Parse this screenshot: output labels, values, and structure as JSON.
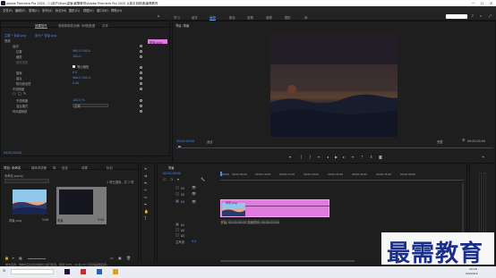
{
  "titlebar": {
    "title": "Adobe Premiere Pro 2020 - C:\\用户\\Xiao\\桌面\\最需教育\\Adobe Premiere Pro 2020 从新手到精通\\最需教育",
    "min": "—",
    "max": "☐",
    "close": "✕"
  },
  "menu": [
    "文件(F)",
    "编辑(E)",
    "剪辑(C)",
    "序列(S)",
    "标记(M)",
    "图形(G)",
    "视图(V)",
    "窗口(W)",
    "帮助(H)"
  ],
  "workspaces": [
    "学习",
    "组件",
    "编辑",
    "颜色",
    "效果",
    "音频",
    "图形",
    "库"
  ],
  "active_workspace": "编辑",
  "effect_controls": {
    "tabs": [
      "效果控件",
      "音频剪辑混合器: 序列",
      "元数据",
      "文本"
    ],
    "active_tab": "效果控件",
    "source": "主要 * 背景.png",
    "seq": "序列 * 背景.png",
    "clip_chip": "背景.png",
    "sections": [
      {
        "name": "视频",
        "indent": 0
      },
      {
        "name": "运动",
        "indent": 1
      },
      {
        "name": "位置",
        "indent": 2,
        "value": "960.0   540.0"
      },
      {
        "name": "缩放",
        "indent": 2,
        "value": "100.0"
      },
      {
        "name": "缩放宽度",
        "indent": 2,
        "value": ""
      },
      {
        "name": "等比缩放",
        "indent": 2,
        "checkbox": true
      },
      {
        "name": "旋转",
        "indent": 2,
        "value": "0.0"
      },
      {
        "name": "锚点",
        "indent": 2,
        "value": "960.0   540.0"
      },
      {
        "name": "防闪烁滤镜",
        "indent": 2,
        "value": "0.00"
      },
      {
        "name": "不透明度",
        "indent": 1
      },
      {
        "name": "不透明度",
        "indent": 2,
        "value": "100.0 %"
      },
      {
        "name": "混合模式",
        "indent": 2,
        "value": "正常"
      },
      {
        "name": "时间重映射",
        "indent": 1
      }
    ],
    "timecode": "00:00:00:00"
  },
  "program_monitor": {
    "tab": "节目: 背景",
    "timecode": "00:00:00:00",
    "zoom": "适合",
    "quality": "完整",
    "duration": "00:00:05:00"
  },
  "project": {
    "tabs": [
      "项目: 未命名",
      "媒体浏览器",
      "库",
      "信息",
      "效果",
      "标记"
    ],
    "project_name": "未命名.prproj",
    "count": "1 项已选择，共 2 项",
    "items": [
      {
        "name": "背景.png",
        "duration": "5:00"
      },
      {
        "name": "背景",
        "duration": "5:00"
      }
    ]
  },
  "timeline": {
    "tab": "背景",
    "timecode": "00:00:00:00",
    "ruler": [
      "00:00",
      "00:00:05:00",
      "00:00:10:00",
      "00:00:15:00",
      "00:00:20:00",
      "00:00:25:00",
      "00:00:30:00",
      "00:00:35:00",
      "00:00:40:00"
    ],
    "video_tracks": [
      "V3",
      "V2",
      "V1"
    ],
    "audio_tracks": [
      "A1",
      "A2",
      "A3"
    ],
    "master": "主声道",
    "master_value": "0.0",
    "clip_label": "背景.png",
    "tooltip": "开始: 00:00:00:00 持续时间: 00:00:05:00"
  },
  "status": "单击选择，或单击空白处并拖动以进行框选。使用 Shift、Alt 和 Ctrl 可获得其他选项。",
  "watermark": "最需教育",
  "taskbar": {
    "time": "16:18",
    "date": "2022/4/9"
  },
  "colors": {
    "accent": "#4b8ce6",
    "clip": "#e07be0",
    "bg": "#1d1d1d",
    "watermark": "#1a2f8a"
  }
}
